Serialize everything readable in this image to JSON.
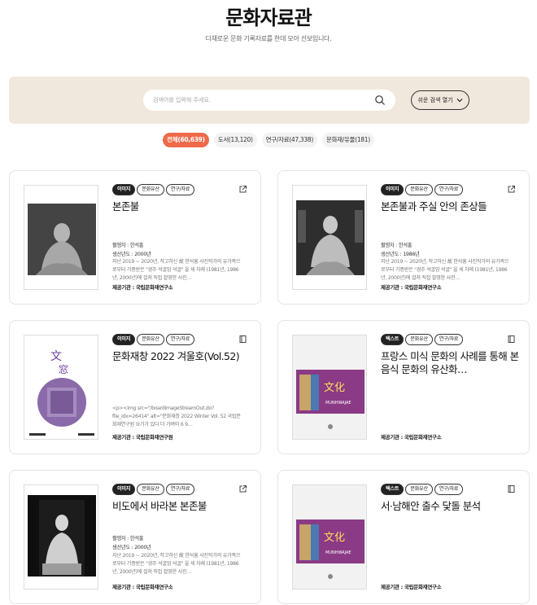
{
  "page": {
    "title": "문화자료관",
    "subtitle": "다채로운 문화 기록자료를 한데 모아 선보입니다."
  },
  "search": {
    "placeholder": "검색어를 입력해 주세요.",
    "advanced_label": "쉬운 검색 열기"
  },
  "tabs": [
    {
      "label": "전체(60,639)",
      "active": true
    },
    {
      "label": "도서(13,120)",
      "active": false
    },
    {
      "label": "연구/자료(47,338)",
      "active": false
    },
    {
      "label": "문화재/유물(181)",
      "active": false
    }
  ],
  "cards": [
    {
      "type_badge": "이미지",
      "badge2": "문화유산",
      "badge3": "연구/자료",
      "title": "본존불",
      "meta1": "촬영자 : 한석홍",
      "meta2": "생산년도 : 2000년",
      "desc": "지난 2019 ~ 2020년, 작고하신 故 한석홍 사진작가의 유가족으로부터 기증받은 \"경주 석굴암 석굴\" 을 세 차례 (1981년, 1986년, 2000년)에 걸쳐 직접 촬영한 사진…",
      "provider": "제공기관 : 국립문화재연구소",
      "icon": "external-link-icon"
    },
    {
      "type_badge": "이미지",
      "badge2": "문화유산",
      "badge3": "연구/자료",
      "title": "본존불과 주실 안의 존상들",
      "meta1": "촬영자 : 한석홍",
      "meta2": "생산년도 : 1986년",
      "desc": "지난 2019 ~ 2020년, 작고하신 故 한석홍 사진작가의 유가족으로부터 기증받은 \"경주 석굴암 석굴\" 을 세 차례 (1981년, 1986년, 2000년)에 걸쳐 직접 촬영한 사진…",
      "provider": "제공기관 : 국립문화재연구소",
      "icon": "external-link-icon"
    },
    {
      "type_badge": "이미지",
      "badge2": "문화유산",
      "badge3": "연구/자료",
      "title": "문화재창 2022 겨울호(Vol.52)",
      "meta1": "",
      "meta2": "",
      "desc": "<p><img src=\"/boardImageStreamOut.do?file_idx=26414\" alt=\"문화재창 2022 Winter Vol. 52 국립문화재연구원 요기가 있다 더 가벼이 6 9…",
      "provider": "제공기관 : 국립문화재연구원",
      "icon": "book-icon"
    },
    {
      "type_badge": "텍스트",
      "badge2": "문화유산",
      "badge3": "연구/자료",
      "title": "프랑스 미식 문화의 사례를 통해 본 음식 문화의 유산화…",
      "meta1": "",
      "meta2": "",
      "desc": "",
      "provider": "제공기관 : 국립문화재연구소",
      "icon": "book-icon"
    },
    {
      "type_badge": "이미지",
      "badge2": "문화유산",
      "badge3": "연구/자료",
      "title": "비도에서 바라본 본존불",
      "meta1": "촬영자 : 한석홍",
      "meta2": "생산년도 : 2000년",
      "desc": "지난 2019 ~ 2020년, 작고하신 故 한석홍 사진작가의 유가족으로부터 기증받은 \"경주 석굴암 석굴\" 을 세 차례 (1981년, 1986년, 2000년)에 걸쳐 직접 촬영한 사진…",
      "provider": "제공기관 : 국립문화재연구소",
      "icon": "external-link-icon"
    },
    {
      "type_badge": "텍스트",
      "badge2": "문화유산",
      "badge3": "연구/자료",
      "title": "서·남해안 출수 닻돌 분석",
      "meta1": "",
      "meta2": "",
      "desc": "",
      "provider": "제공기관 : 국립문화재연구소",
      "icon": "book-icon"
    }
  ],
  "colors": {
    "accent": "#ee6a4a",
    "panel": "#f1e8dd",
    "badge_dark": "#222222"
  }
}
